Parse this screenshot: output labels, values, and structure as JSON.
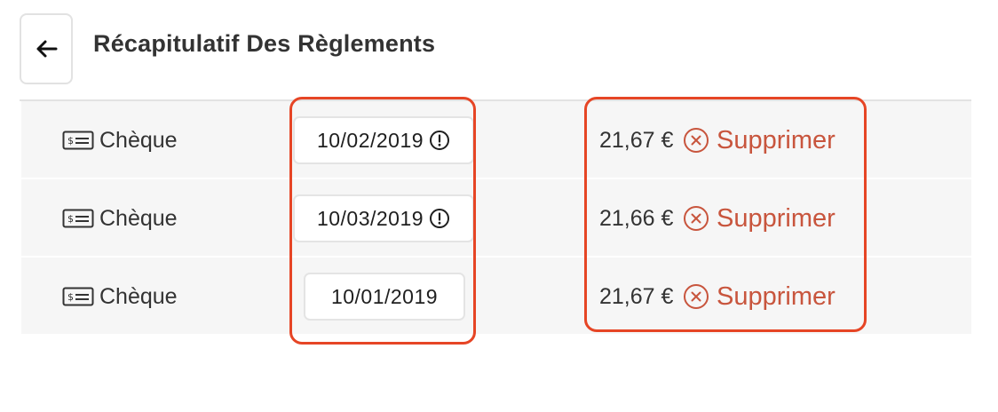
{
  "header": {
    "title": "Récapitulatif Des Règlements",
    "back_icon": "arrow-left-icon"
  },
  "payments": [
    {
      "method": "Chèque",
      "method_icon": "cheque-icon",
      "date": "10/02/2019",
      "date_warning": true,
      "amount": "21,67 €",
      "delete_label": "Supprimer"
    },
    {
      "method": "Chèque",
      "method_icon": "cheque-icon",
      "date": "10/03/2019",
      "date_warning": true,
      "amount": "21,66 €",
      "delete_label": "Supprimer"
    },
    {
      "method": "Chèque",
      "method_icon": "cheque-icon",
      "date": "10/01/2019",
      "date_warning": false,
      "amount": "21,67 €",
      "delete_label": "Supprimer"
    }
  ],
  "colors": {
    "delete": "#c8553d",
    "highlight": "#e64525",
    "row_background": "#f6f6f6"
  }
}
